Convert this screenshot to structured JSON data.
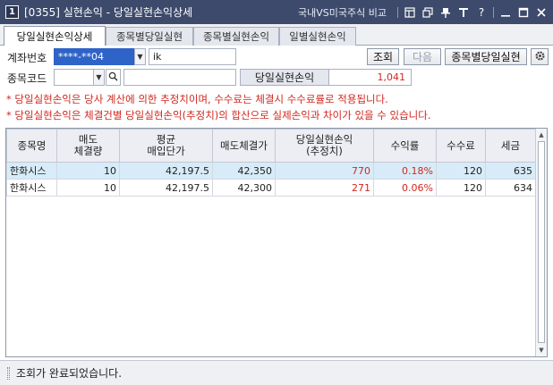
{
  "window": {
    "number": "1",
    "title": "[0355] 실현손익 - 당일실현손익상세",
    "right_link": "국내VS미국주식 비교",
    "help": "?"
  },
  "tabs": [
    {
      "label": "당일실현손익상세",
      "active": true
    },
    {
      "label": "종목별당일실현"
    },
    {
      "label": "종목별실현손익"
    },
    {
      "label": "일별실현손익"
    }
  ],
  "form": {
    "account_label": "계좌번호",
    "account_value": "****-**04",
    "account_name": "ik",
    "query_button": "조회",
    "next_button": "다음",
    "by_stock_button": "종목별당일실현",
    "stock_code_label": "종목코드",
    "stock_code_value": "",
    "stock_name_value": "",
    "daily_pnl_label": "당일실현손익",
    "daily_pnl_value": "1,041"
  },
  "notices": [
    "* 당일실현손익은 당사 계산에 의한 추정치이며, 수수료는 체결시 수수료률로 적용됩니다.",
    "* 당일실현손익은 체결건별 당일실현손익(추정치)의 합산으로 실제손익과 차이가 있을 수 있습니다."
  ],
  "grid": {
    "headers": [
      {
        "l1": "종목명",
        "l2": ""
      },
      {
        "l1": "매도",
        "l2": "체결량"
      },
      {
        "l1": "평균",
        "l2": "매입단가"
      },
      {
        "l1": "매도체결가",
        "l2": ""
      },
      {
        "l1": "당일실현손익",
        "l2": "(추정치)"
      },
      {
        "l1": "수익률",
        "l2": ""
      },
      {
        "l1": "수수료",
        "l2": ""
      },
      {
        "l1": "세금",
        "l2": ""
      }
    ],
    "rows": [
      [
        "한화시스",
        "10",
        "42,197.5",
        "42,350",
        "770",
        "0.18%",
        "120",
        "635"
      ],
      [
        "한화시스",
        "10",
        "42,197.5",
        "42,300",
        "271",
        "0.06%",
        "120",
        "634"
      ]
    ]
  },
  "status": {
    "message": "조회가 완료되었습니다."
  },
  "colors": {
    "titlebar": "#3d4a6b",
    "selection": "#2e63c7",
    "profit": "#d0281f",
    "selected_row": "#d7ecf8"
  }
}
